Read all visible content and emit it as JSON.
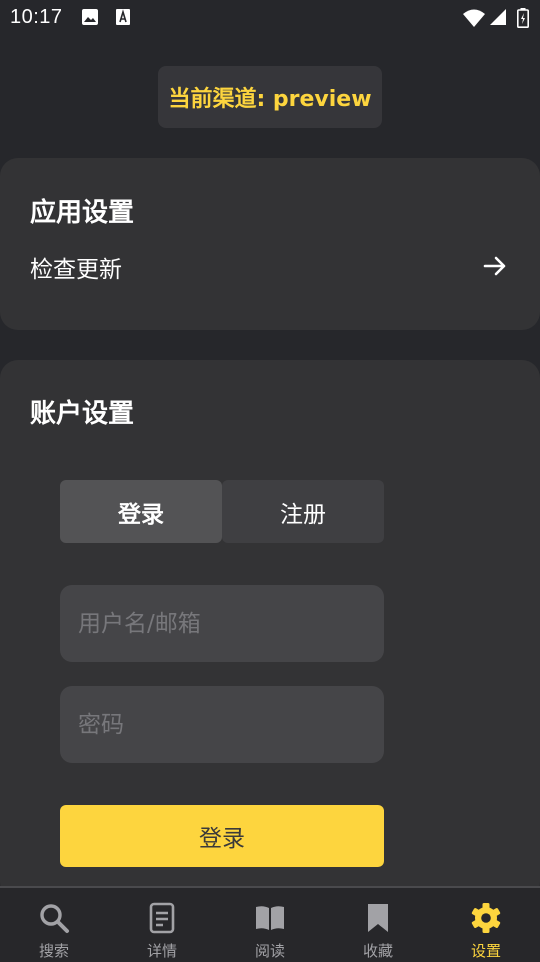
{
  "status_bar": {
    "time": "10:17"
  },
  "channel": {
    "text": "当前渠道: preview"
  },
  "app_settings": {
    "title": "应用设置",
    "check_update": "检查更新"
  },
  "account_settings": {
    "title": "账户设置",
    "tabs": {
      "login": "登录",
      "register": "注册"
    },
    "username_placeholder": "用户名/邮箱",
    "password_placeholder": "密码",
    "submit_label": "登录"
  },
  "bottom_nav": {
    "items": [
      {
        "label": "搜索",
        "icon": "search-icon"
      },
      {
        "label": "详情",
        "icon": "document-icon"
      },
      {
        "label": "阅读",
        "icon": "book-icon"
      },
      {
        "label": "收藏",
        "icon": "bookmark-icon"
      },
      {
        "label": "设置",
        "icon": "gear-icon"
      }
    ],
    "active_index": 4
  },
  "colors": {
    "accent": "#fdd53e",
    "background": "#26272b",
    "card": "#333335"
  }
}
